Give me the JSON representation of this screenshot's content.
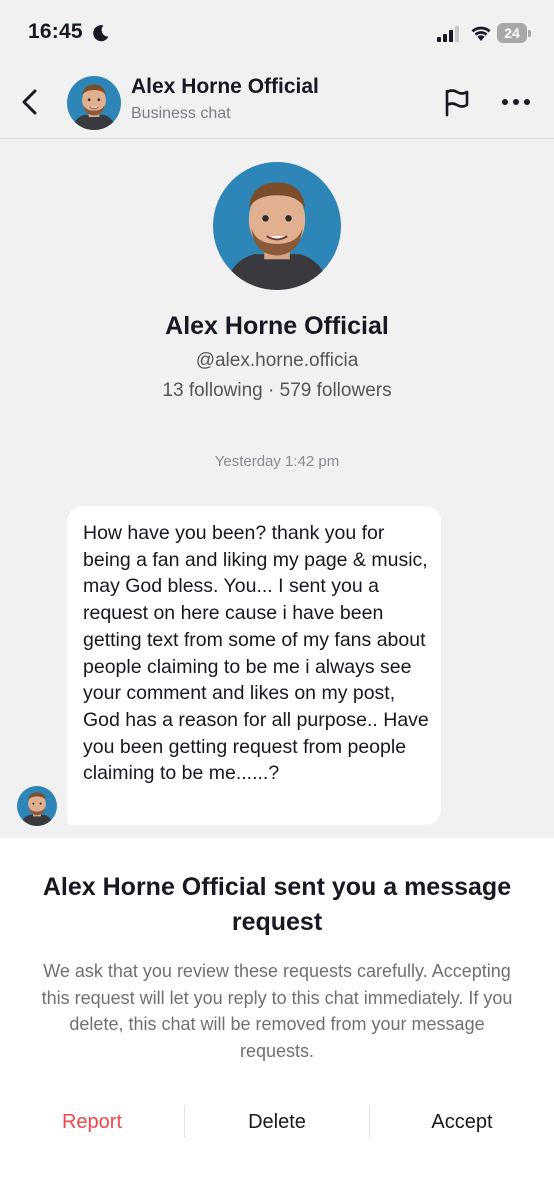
{
  "status_bar": {
    "time": "16:45",
    "battery": "24",
    "icons": [
      "moon-icon",
      "signal-icon",
      "wifi-icon",
      "battery-icon"
    ]
  },
  "header": {
    "name": "Alex Horne Official",
    "subtitle": "Business chat",
    "icons": [
      "back-arrow-icon",
      "flag-icon",
      "more-icon"
    ]
  },
  "profile": {
    "name": "Alex Horne Official",
    "handle": "@alex.horne.officia",
    "stats": "13 following · 579 followers"
  },
  "chat": {
    "timestamp": "Yesterday 1:42 pm",
    "message": "How have you been? thank you for being a fan and liking my page & music, may God bless. You... I sent you a request on here cause i have been getting text from some of my fans about people claiming to be me i always see your comment and likes on my post, God has a reason for all purpose.. Have you been getting request from people claiming to be me......?"
  },
  "request_panel": {
    "title": "Alex Horne Official sent you a message request",
    "description": "We ask that you review these requests carefully. Accepting this request will let you reply to this chat immediately. If you delete, this chat will be removed from your message requests.",
    "report_label": "Report",
    "delete_label": "Delete",
    "accept_label": "Accept"
  },
  "colors": {
    "report": "#f0464b",
    "avatar_bg": "#2e86b8",
    "background": "#f1f1f2"
  }
}
